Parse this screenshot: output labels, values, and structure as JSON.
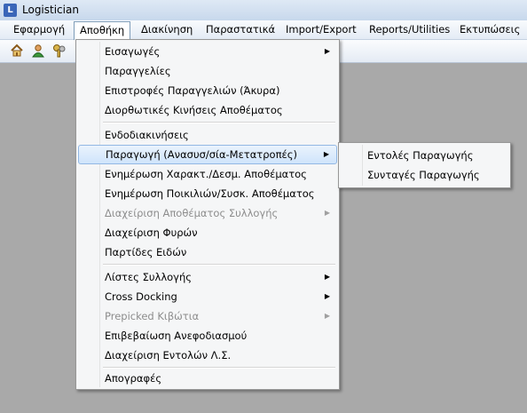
{
  "window": {
    "title": "Logistician"
  },
  "menubar": [
    {
      "label": "Εφαρμογή"
    },
    {
      "label": "Αποθήκη"
    },
    {
      "label": "Διακίνηση"
    },
    {
      "label": "Παραστατικά"
    },
    {
      "label": "Import/Export"
    },
    {
      "label": "Reports/Utilities"
    },
    {
      "label": "Εκτυπώσεις"
    }
  ],
  "toolbar": {
    "icons": [
      "home-icon",
      "user-icon",
      "keys-icon"
    ]
  },
  "main_menu": {
    "items": [
      {
        "label": "Εισαγωγές",
        "submenu": true,
        "disabled": false
      },
      {
        "label": "Παραγγελίες",
        "submenu": false,
        "disabled": false
      },
      {
        "label": "Επιστροφές Παραγγελιών (Άκυρα)",
        "submenu": false,
        "disabled": false
      },
      {
        "label": "Διορθωτικές Κινήσεις Αποθέματος",
        "submenu": false,
        "disabled": false
      },
      {
        "label": "Ενδοδιακινήσεις",
        "submenu": false,
        "disabled": false
      },
      {
        "label": "Παραγωγή (Ανασυσ/σία-Μετατροπές)",
        "submenu": true,
        "disabled": false
      },
      {
        "label": "Ενημέρωση Χαρακτ./Δεσμ. Αποθέματος",
        "submenu": false,
        "disabled": false
      },
      {
        "label": "Ενημέρωση Ποικιλιών/Συσκ. Αποθέματος",
        "submenu": false,
        "disabled": false
      },
      {
        "label": "Διαχείριση Αποθέματος Συλλογής",
        "submenu": true,
        "disabled": true
      },
      {
        "label": "Διαχείριση Φυρών",
        "submenu": false,
        "disabled": false
      },
      {
        "label": "Παρτίδες Ειδών",
        "submenu": false,
        "disabled": false
      },
      {
        "label": "Λίστες Συλλογής",
        "submenu": true,
        "disabled": false
      },
      {
        "label": "Cross Docking",
        "submenu": true,
        "disabled": false
      },
      {
        "label": "Prepicked Κιβώτια",
        "submenu": true,
        "disabled": true
      },
      {
        "label": "Επιβεβαίωση Ανεφοδιασμού",
        "submenu": false,
        "disabled": false
      },
      {
        "label": "Διαχείριση Εντολών Λ.Σ.",
        "submenu": false,
        "disabled": false
      },
      {
        "label": "Απογραφές",
        "submenu": false,
        "disabled": false
      }
    ],
    "arrow_glyph": "▶"
  },
  "sub_menu": {
    "items": [
      {
        "label": "Εντολές Παραγωγής"
      },
      {
        "label": "Συνταγές Παραγωγής"
      }
    ]
  }
}
